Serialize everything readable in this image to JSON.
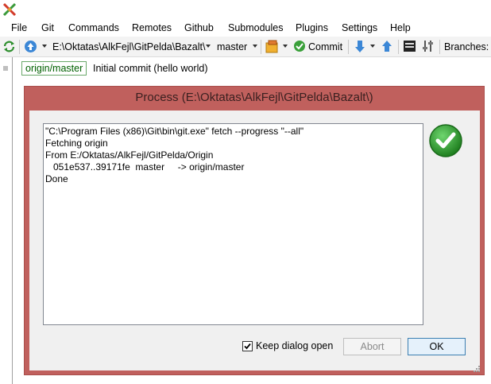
{
  "menu": {
    "items": [
      "File",
      "Git",
      "Commands",
      "Remotes",
      "Github",
      "Submodules",
      "Plugins",
      "Settings",
      "Help"
    ]
  },
  "toolbar": {
    "repo_path": "E:\\Oktatas\\AlkFejl\\GitPelda\\Bazalt\\",
    "branch": "master",
    "commit_label": "Commit",
    "branches_label": "Branches:"
  },
  "revision": {
    "branch_tag": "origin/master",
    "message": "Initial commit (hello world)"
  },
  "dialog": {
    "title": "Process (E:\\Oktatas\\AlkFejl\\GitPelda\\Bazalt\\)",
    "output": "\"C:\\Program Files (x86)\\Git\\bin\\git.exe\" fetch --progress \"--all\"\nFetching origin\nFrom E:/Oktatas/AlkFejl/GitPelda/Origin\n   051e537..39171fe  master     -> origin/master\nDone",
    "keep_open_label": "Keep dialog open",
    "keep_open_checked": true,
    "abort_label": "Abort",
    "ok_label": "OK"
  },
  "colors": {
    "dialog_frame": "#c0605d",
    "branch_tag_text": "#006000",
    "success_green": "#2e9e2e"
  }
}
